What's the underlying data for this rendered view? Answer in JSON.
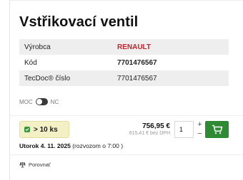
{
  "product": {
    "title": "Vstřikovací ventil"
  },
  "specs": [
    {
      "key": "Výrobca",
      "value": "RENAULT"
    },
    {
      "key": "Kód",
      "value": "7701476567"
    },
    {
      "key": "TecDoc® číslo",
      "value": "7701476567"
    }
  ],
  "toggle": {
    "left_label": "MOC",
    "right_label": "NC"
  },
  "stock": {
    "label": "> 10 ks",
    "color": "#2f9b3a"
  },
  "price": {
    "gross": "756,95 €",
    "net": "615,41 € bez DPH"
  },
  "cart": {
    "quantity": "1",
    "plus": "+",
    "minus": "−",
    "button_color": "#2e8b34"
  },
  "delivery": {
    "date": "Utorok 4. 11. 2025",
    "note": " (rozvozom o 7:00 )"
  },
  "compare": {
    "label": "Porovnať"
  },
  "colors": {
    "brand": "#c1272d"
  }
}
